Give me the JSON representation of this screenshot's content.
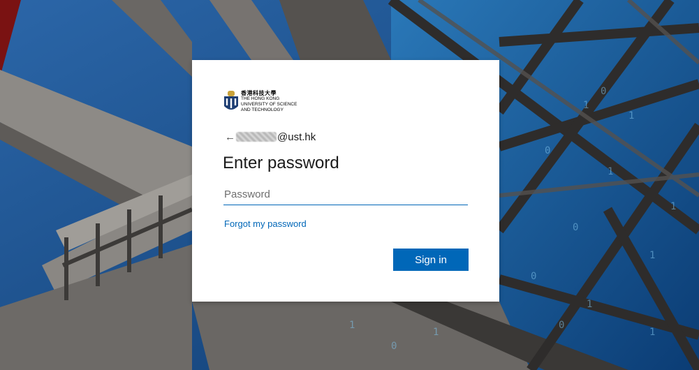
{
  "brand": {
    "name_cn": "香港科技大學",
    "name_en_lines": [
      "THE HONG KONG",
      "UNIVERSITY OF SCIENCE",
      "AND TECHNOLOGY"
    ]
  },
  "identity": {
    "email_suffix": "@ust.hk"
  },
  "form": {
    "title": "Enter password",
    "password_placeholder": "Password",
    "forgot_link": "Forgot my password",
    "submit_label": "Sign in"
  },
  "colors": {
    "accent": "#0067b8",
    "background": "#1d4f86"
  },
  "icons": {
    "back": "left-arrow-icon",
    "logo": "hkust-logo-icon"
  }
}
